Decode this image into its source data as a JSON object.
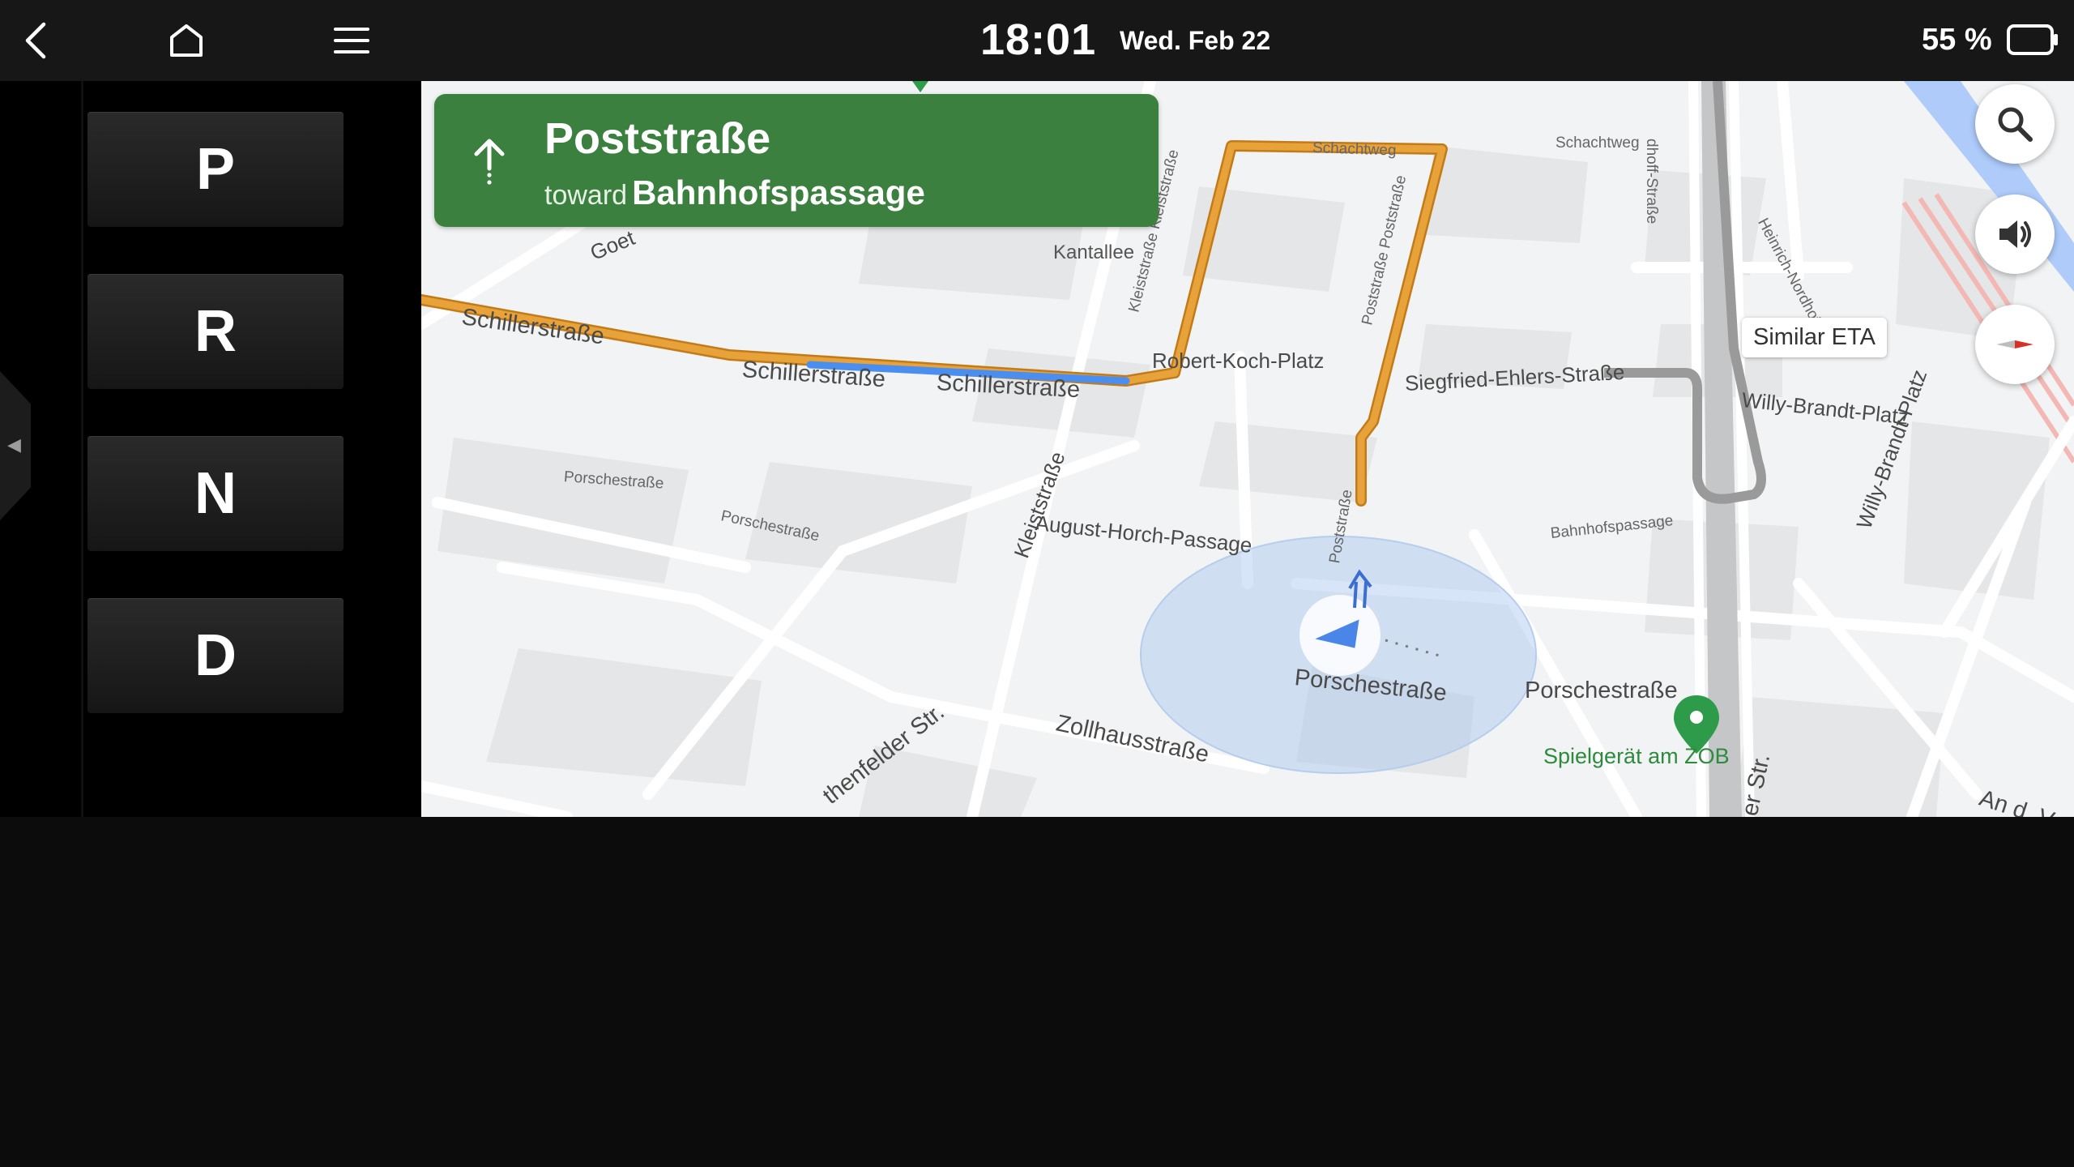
{
  "statusbar": {
    "time": "18:01",
    "date": "Wed. Feb 22",
    "battery": "55 %",
    "icons": [
      "back-icon",
      "home-icon",
      "menu-icon",
      "battery-icon"
    ]
  },
  "gears": [
    "P",
    "R",
    "N",
    "D"
  ],
  "navigation": {
    "street": "Poststraße",
    "toward_label": "toward",
    "destination": "Bahnhofspassage",
    "direction_icon": "arrow-up-icon",
    "color": "#3b803e"
  },
  "map": {
    "route_color": "#e8a23a",
    "current_route_color": "#4a8ef0",
    "eta_bubble": "Similar ETA",
    "poi": "Spielgerät am ZOB",
    "streets": {
      "schillerstrasse": "Schillerstraße",
      "goethe": "Goet",
      "kantallee": "Kantallee",
      "kleiststrasse": "Kleiststraße",
      "kleiststrasse_route": "Kleiststraße Kleiststraße",
      "schachtweg": "Schachtweg",
      "poststrasse_route": "Poststraße Poststraße",
      "poststrasse": "Poststraße",
      "robert_koch_platz": "Robert-Koch-Platz",
      "siegfried_ehlers": "Siegfried-Ehlers-Straße",
      "porschestrasse": "Porschestraße",
      "august_horch": "August-Horch-Passage",
      "bahnhofspassage": "Bahnhofspassage",
      "zollhausstrasse": "Zollhausstraße",
      "rothenfelder": "thenfelder Str.",
      "heinrich_nordhoff": "Heinrich-Nordhoff-Str.",
      "nordhoff_strasse": "dhoff-Straße",
      "willy_brandt_platz": "Willy-Brandt-Platz",
      "an_d_vo": "An d. Vo",
      "er_str": "er Str."
    },
    "buttons": [
      "search-icon",
      "volume-icon",
      "compass-icon"
    ]
  }
}
